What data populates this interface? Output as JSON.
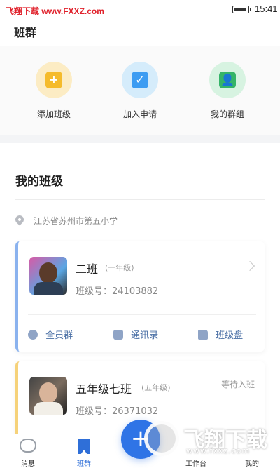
{
  "status_bar": {
    "watermark": "飞翔下载 www.FXXZ.com",
    "time": "15:41"
  },
  "header": {
    "title": "班群"
  },
  "quick_actions": [
    {
      "label": "添加班级",
      "icon": "add-class-icon",
      "color": "#f5bb2c"
    },
    {
      "label": "加入申请",
      "icon": "join-request-icon",
      "color": "#3c9cf2"
    },
    {
      "label": "我的群组",
      "icon": "my-groups-icon",
      "color": "#35b468"
    }
  ],
  "section": {
    "title": "我的班级",
    "location": "江苏省苏州市第五小学"
  },
  "classes": [
    {
      "name": "二班",
      "grade": "(一年级)",
      "class_no": "班级号：24103882",
      "actions": [
        "全员群",
        "通讯录",
        "班级盘"
      ]
    },
    {
      "name": "五年级七班",
      "grade": "(五年级)",
      "class_no": "班级号：26371032",
      "status": "等待入班"
    }
  ],
  "bottom_nav": [
    {
      "label": "消息",
      "icon": "message-icon"
    },
    {
      "label": "班群",
      "icon": "class-group-icon",
      "active": true
    },
    {
      "label": "工作台",
      "icon": "workbench-icon"
    },
    {
      "label": "我的",
      "icon": "profile-icon"
    }
  ],
  "overlay_watermark": {
    "text": "飞翔下载",
    "url": "www.fxxz.com"
  },
  "colors": {
    "accent": "#2f6fd8",
    "card_stripe_1": "#8ab2ee",
    "card_stripe_2": "#f6d27a"
  }
}
